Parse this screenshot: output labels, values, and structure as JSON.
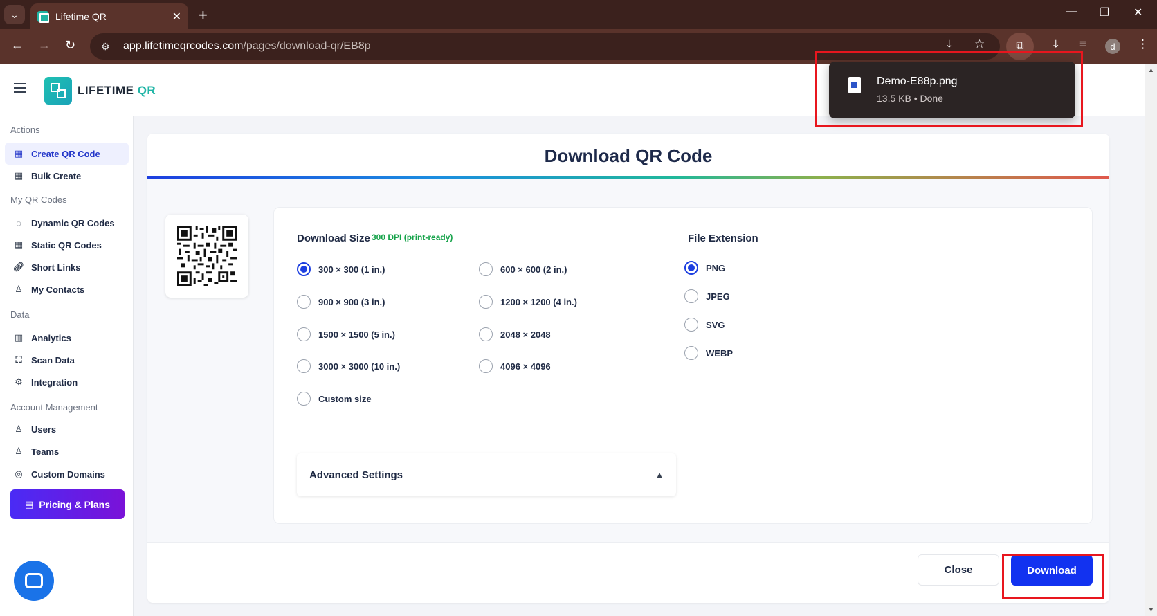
{
  "browser": {
    "tab_title": "Lifetime QR",
    "url_host": "app.lifetimeqrcodes.com",
    "url_path": "/pages/download-qr/EB8p",
    "profile_initial": "d"
  },
  "header": {
    "brand_main": "LIFETIME",
    "brand_accent": "QR"
  },
  "sidebar": {
    "sections": {
      "actions": "Actions",
      "my_qr": "My QR Codes",
      "data": "Data",
      "account": "Account Management"
    },
    "items": {
      "create": "Create QR Code",
      "bulk": "Bulk Create",
      "dynamic": "Dynamic QR Codes",
      "static": "Static QR Codes",
      "short": "Short Links",
      "contacts": "My Contacts",
      "analytics": "Analytics",
      "scan": "Scan Data",
      "integration": "Integration",
      "users": "Users",
      "teams": "Teams",
      "domains": "Custom Domains"
    },
    "pricing_label": "Pricing & Plans"
  },
  "main": {
    "title": "Download QR Code",
    "size_label": "Download Size",
    "dpi_note": "300 DPI (print-ready)",
    "ext_label": "File Extension",
    "sizes": [
      "300 × 300 (1 in.)",
      "600 × 600 (2 in.)",
      "900 × 900 (3 in.)",
      "1200 × 1200 (4 in.)",
      "1500 × 1500 (5 in.)",
      "2048 × 2048",
      "3000 × 3000 (10 in.)",
      "4096 × 4096",
      "Custom size"
    ],
    "selected_size": "300 × 300 (1 in.)",
    "extensions": [
      "PNG",
      "JPEG",
      "SVG",
      "WEBP"
    ],
    "selected_extension": "PNG",
    "advanced_label": "Advanced Settings",
    "close_label": "Close",
    "download_label": "Download"
  },
  "download_popup": {
    "filename": "Demo-E88p.png",
    "meta": "13.5 KB • Done"
  },
  "colors": {
    "primary": "#1232f0",
    "brand_teal": "#1fb5a6",
    "highlight": "#e8161e",
    "chrome": "#5a332b"
  }
}
